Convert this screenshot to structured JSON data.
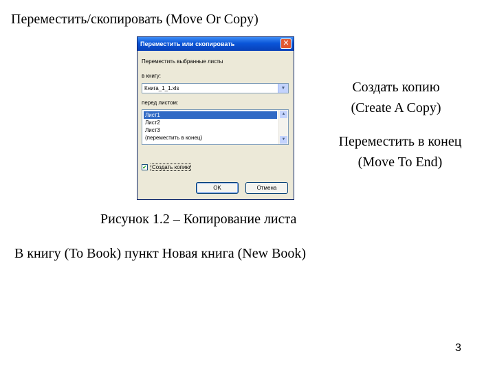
{
  "slide": {
    "title": "Переместить/скопировать (Move Or Copy)",
    "caption": "Рисунок 1.2 – Копирование листа",
    "note": "В книгу (To Book) пункт Новая книга (New Book)",
    "page_number": "3"
  },
  "annotations": {
    "create_copy": [
      "Создать копию",
      "(Create A Copy)"
    ],
    "move_to_end": [
      "Переместить в конец",
      "(Move To End)"
    ]
  },
  "dialog": {
    "title": "Переместить или скопировать",
    "prompt": "Переместить выбранные листы",
    "book_label": "в книгу:",
    "book_value": "Книга_1_1.xls",
    "before_label": "перед листом:",
    "sheets": [
      "Лист1",
      "Лист2",
      "Лист3",
      "(переместить в конец)"
    ],
    "selected_sheet_index": 0,
    "create_copy_label": "Создать копию",
    "create_copy_checked": true,
    "ok_label": "OK",
    "cancel_label": "Отмена"
  }
}
